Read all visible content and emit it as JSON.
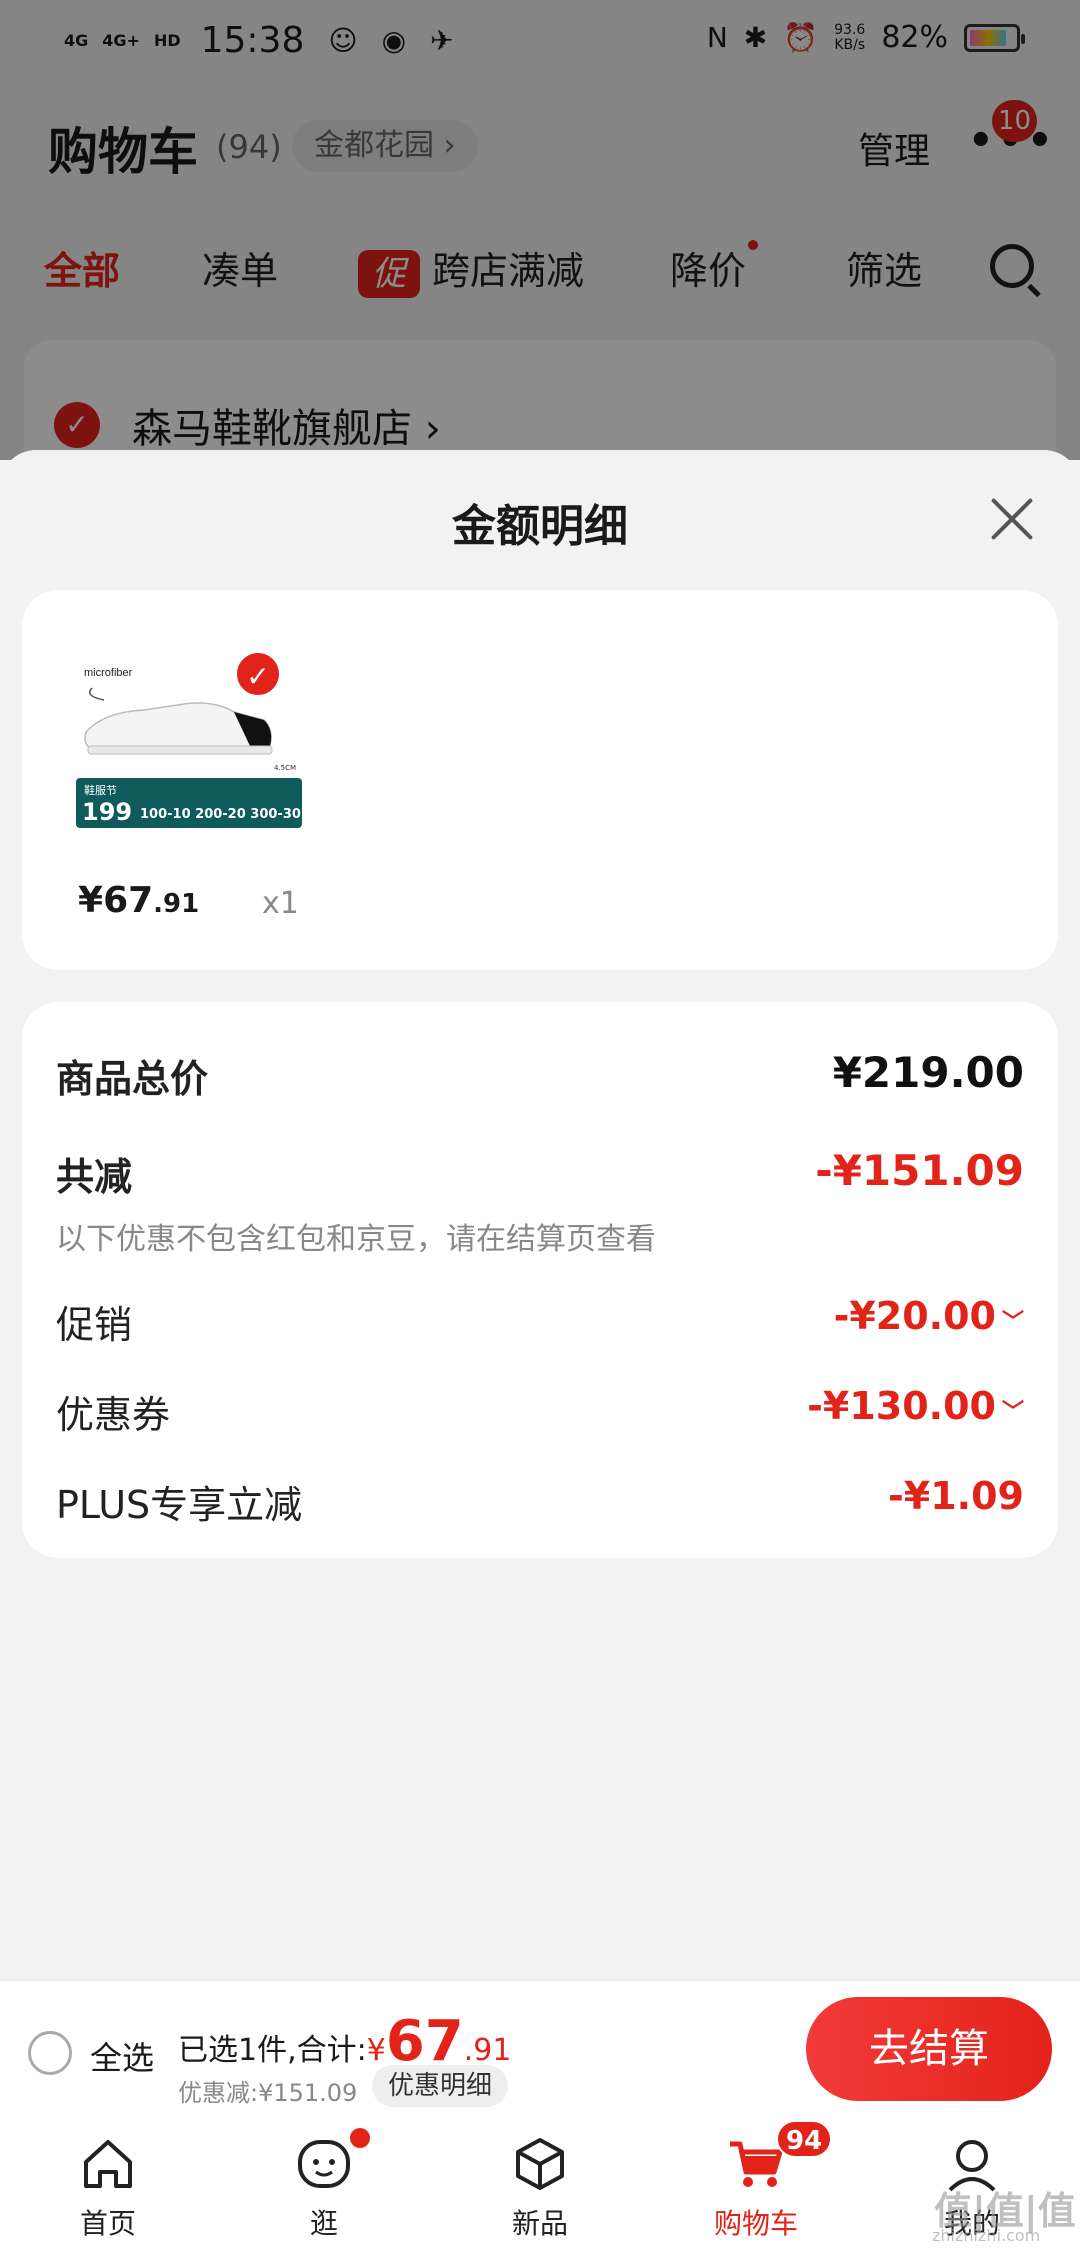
{
  "status_bar": {
    "signal1": "4G",
    "signal2": "4G+",
    "hd": "HD",
    "time": "15:38",
    "speed": "93.6",
    "speed_unit": "KB/s",
    "battery": "82%",
    "battery_level": 0.82
  },
  "header": {
    "title": "购物车",
    "count": "(94)",
    "location": "金都花园 ›",
    "manage": "管理",
    "more_icon": "•••",
    "badge": "10"
  },
  "filters": {
    "all": "全部",
    "bundle": "凑单",
    "promo_tag": "促",
    "cross_store": "跨店满减",
    "price_drop": "降价",
    "filter": "筛选"
  },
  "store": {
    "name": "森马鞋靴旗舰店 ›"
  },
  "sheet": {
    "title": "金额明细",
    "product": {
      "image_text": "microfiber",
      "image_promo_label": "鞋服节",
      "image_promo_price": "199",
      "image_promo_tiers": "100-10 200-20 300-30",
      "image_size": "4.5CM",
      "price_currency": "¥",
      "price_int": "67",
      "price_dec": ".91",
      "qty": "x1"
    },
    "details": {
      "total_label": "商品总价",
      "total_value": "¥219.00",
      "reduce_label": "共减",
      "reduce_value": "-¥151.09",
      "note": "以下优惠不包含红包和京豆，请在结算页查看",
      "promo_label": "促销",
      "promo_value": "-¥20.00",
      "coupon_label": "优惠券",
      "coupon_value": "-¥130.00",
      "plus_label": "PLUS专享立减",
      "plus_value": "-¥1.09"
    }
  },
  "checkout": {
    "select_all": "全选",
    "selected_text": "已选1件,合计:",
    "currency": "¥",
    "total_int": "67",
    "total_dec": ".91",
    "discount_text": "优惠减:¥151.09",
    "detail_button": "优惠明细",
    "checkout_button": "去结算"
  },
  "tabbar": {
    "home": "首页",
    "browse": "逛",
    "new": "新品",
    "cart": "购物车",
    "cart_badge": "94",
    "mine": "我的"
  },
  "watermark": {
    "main": "值|值|值",
    "sub": "zhizhizhi.com"
  },
  "colors": {
    "accent": "#e2231a",
    "background": "#f2f2f2"
  }
}
